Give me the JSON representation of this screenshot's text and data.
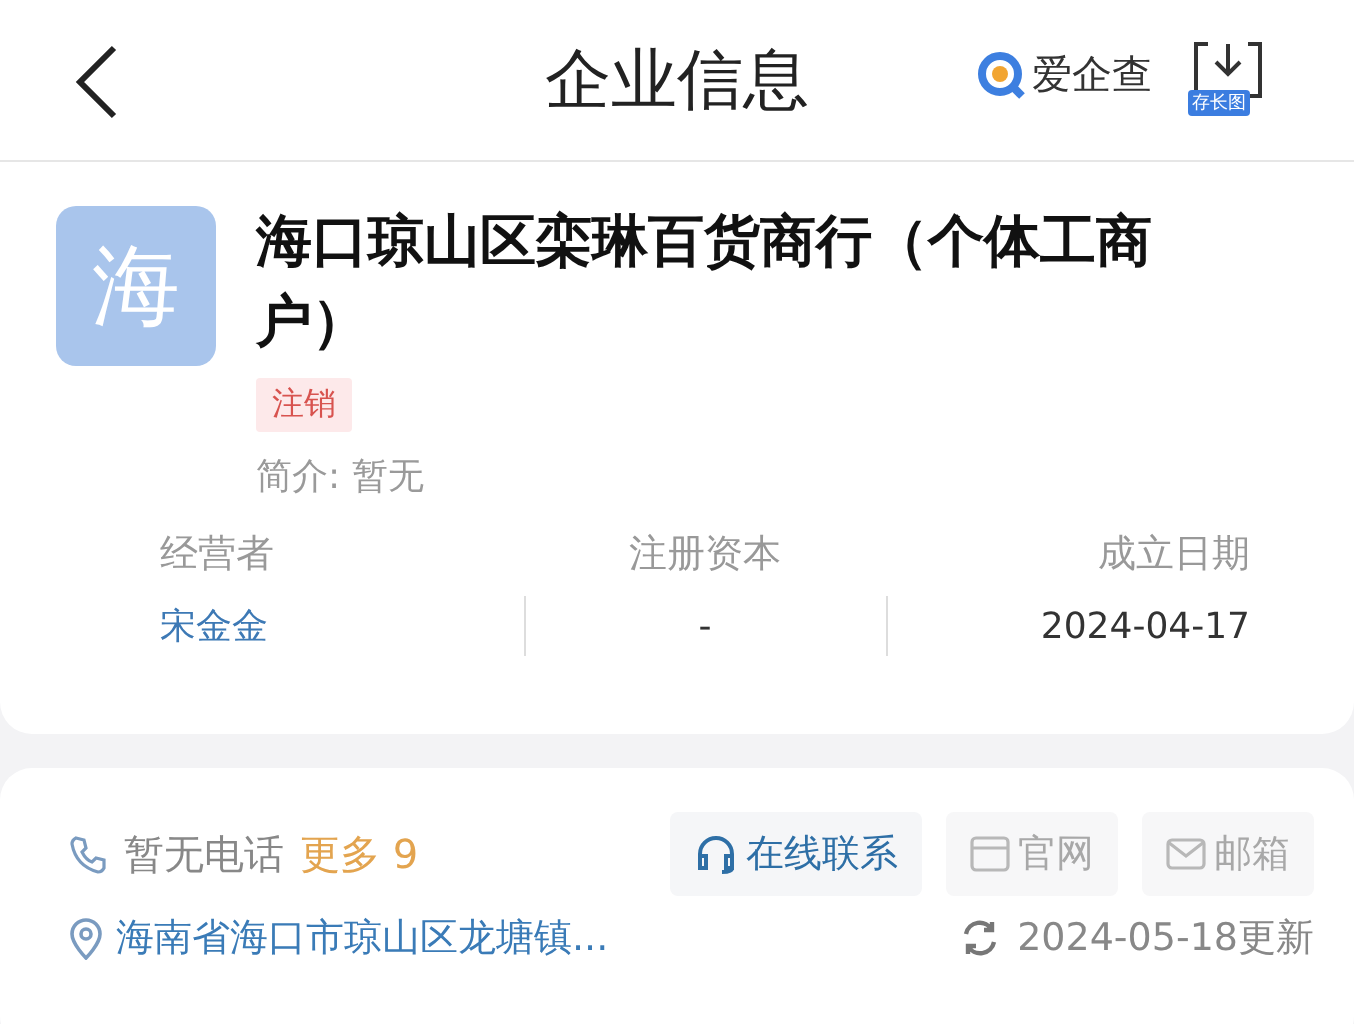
{
  "header": {
    "title": "企业信息",
    "brand": "爱企查",
    "save_label": "存长图"
  },
  "company": {
    "avatar": "海",
    "name": "海口琼山区栾琳百货商行（个体工商户）",
    "status": "注销",
    "intro_label": "简介:",
    "intro": "暂无",
    "facts": [
      {
        "label": "经营者",
        "value": "宋金金",
        "kind": "link"
      },
      {
        "label": "注册资本",
        "value": "-",
        "kind": "plain"
      },
      {
        "label": "成立日期",
        "value": "2024-04-17",
        "kind": "plain"
      }
    ]
  },
  "contact": {
    "phone": "暂无电话",
    "more": "更多 9",
    "actions": [
      {
        "label": "在线联系",
        "kind": "headset",
        "disabled": false
      },
      {
        "label": "官网",
        "kind": "web",
        "disabled": true
      },
      {
        "label": "邮箱",
        "kind": "mail",
        "disabled": true
      }
    ],
    "address": "海南省海口市琼山区龙塘镇...",
    "updated": "2024-05-18更新"
  }
}
